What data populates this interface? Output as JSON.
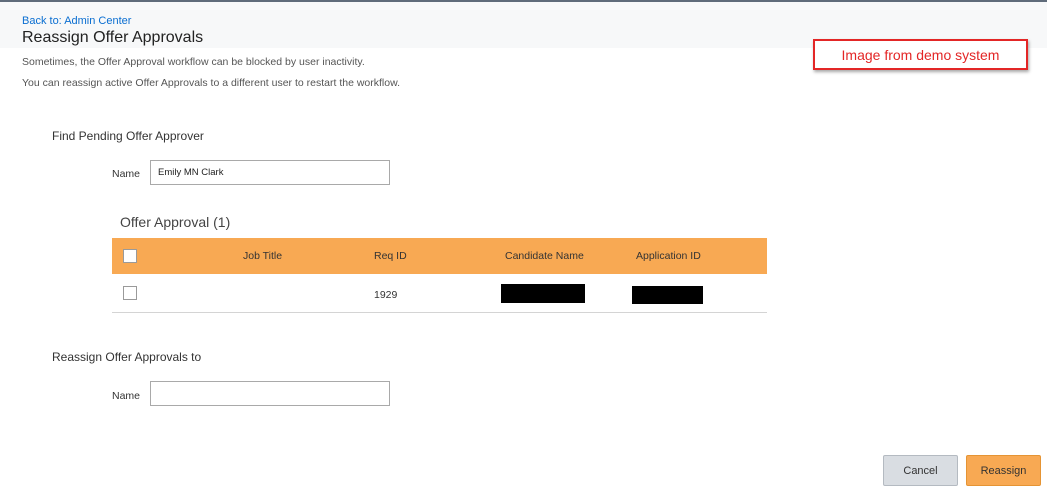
{
  "header": {
    "back_link": "Back to: Admin Center",
    "title": "Reassign Offer Approvals"
  },
  "intro": {
    "line1": "Sometimes, the Offer Approval workflow can be blocked by user inactivity.",
    "line2": "You can reassign active Offer Approvals to a different user to restart the workflow."
  },
  "demo_badge": "Image from demo system",
  "find_section": {
    "heading": "Find Pending Offer Approver",
    "name_label": "Name",
    "name_value": "Emily MN Clark"
  },
  "table": {
    "caption": "Offer Approval (1)",
    "columns": [
      "Job Title",
      "Req ID",
      "Candidate Name",
      "Application ID"
    ],
    "rows": [
      {
        "job_title": "",
        "req_id": "1929",
        "candidate_name_redacted": true,
        "application_id_redacted": true
      }
    ],
    "header_color": "#f8a953"
  },
  "reassign_section": {
    "heading": "Reassign Offer Approvals to",
    "name_label": "Name",
    "name_value": ""
  },
  "buttons": {
    "cancel": "Cancel",
    "reassign": "Reassign"
  },
  "colors": {
    "accent": "#f8a953",
    "link": "#0a6ed1",
    "badge": "#e32626"
  }
}
